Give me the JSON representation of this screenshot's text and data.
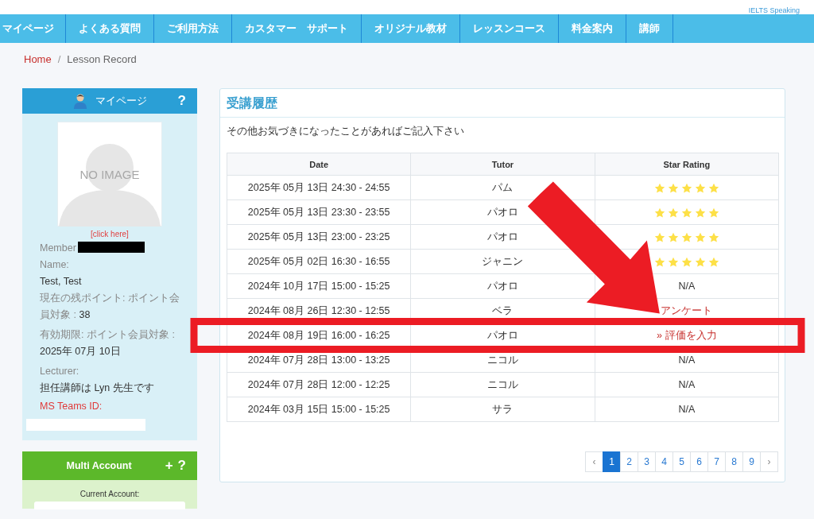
{
  "header_link": "IELTS Speaking",
  "nav": [
    {
      "label": "マイページ"
    },
    {
      "label": "よくある質問"
    },
    {
      "label": "ご利用方法"
    },
    {
      "label": "カスタマー　サポート"
    },
    {
      "label": "オリジナル教材"
    },
    {
      "label": "レッスンコース"
    },
    {
      "label": "料金案内"
    },
    {
      "label": "講師"
    }
  ],
  "breadcrumb": {
    "home": "Home",
    "separator": "/",
    "current": "Lesson Record"
  },
  "profile": {
    "title": "マイページ",
    "help": "?",
    "photo_text": "NO IMAGE",
    "photo_link": "[click here]",
    "member_label": "Member",
    "name_label": "Name:",
    "name": "Test, Test",
    "points_label": "現在の残ポイント: ポイント会員対象 :",
    "points": "38",
    "expiry_label": "有効期限: ポイント会員対象 :",
    "expiry": "2025年 07月 10日",
    "lecturer_label": "Lecturer:",
    "lecturer": "担任講師は Lyn 先生です",
    "teams_label": "MS Teams ID:"
  },
  "multi_account": {
    "title": "Multi Account",
    "add": "+",
    "help": "?",
    "current_label": "Current Account:"
  },
  "record": {
    "title": "受講履歴",
    "note": "その他お気づきになったことがあればご記入下さい",
    "columns": [
      "Date",
      "Tutor",
      "Star Rating"
    ],
    "rows": [
      {
        "date": "2025年 05月 13日 24:30 - 24:55",
        "tutor": "パム",
        "rating": {
          "kind": "stars",
          "stars": 5
        },
        "highlighted": false
      },
      {
        "date": "2025年 05月 13日 23:30 - 23:55",
        "tutor": "パオロ",
        "rating": {
          "kind": "stars",
          "stars": 5
        },
        "highlighted": false
      },
      {
        "date": "2025年 05月 13日 23:00 - 23:25",
        "tutor": "パオロ",
        "rating": {
          "kind": "stars",
          "stars": 5
        },
        "highlighted": false
      },
      {
        "date": "2025年 05月 02日 16:30 - 16:55",
        "tutor": "ジャニン",
        "rating": {
          "kind": "stars",
          "stars": 5
        },
        "highlighted": false
      },
      {
        "date": "2024年 10月 17日 15:00 - 15:25",
        "tutor": "パオロ",
        "rating": {
          "kind": "text",
          "text": "N/A"
        },
        "highlighted": false
      },
      {
        "date": "2024年 08月 26日 12:30 - 12:55",
        "tutor": "ベラ",
        "rating": {
          "kind": "link",
          "text": "アンケート"
        },
        "highlighted": false
      },
      {
        "date": "2024年 08月 19日 16:00 - 16:25",
        "tutor": "パオロ",
        "rating": {
          "kind": "link",
          "text": "» 評価を入力"
        },
        "highlighted": true
      },
      {
        "date": "2024年 07月 28日 13:00 - 13:25",
        "tutor": "ニコル",
        "rating": {
          "kind": "text",
          "text": "N/A"
        },
        "highlighted": false
      },
      {
        "date": "2024年 07月 28日 12:00 - 12:25",
        "tutor": "ニコル",
        "rating": {
          "kind": "text",
          "text": "N/A"
        },
        "highlighted": false
      },
      {
        "date": "2024年 03月 15日 15:00 - 15:25",
        "tutor": "サラ",
        "rating": {
          "kind": "text",
          "text": "N/A"
        },
        "highlighted": false
      }
    ],
    "pagination": [
      {
        "label": "‹",
        "selected": false
      },
      {
        "label": "1",
        "selected": true
      },
      {
        "label": "2",
        "selected": false
      },
      {
        "label": "3",
        "selected": false
      },
      {
        "label": "4",
        "selected": false
      },
      {
        "label": "5",
        "selected": false
      },
      {
        "label": "6",
        "selected": false
      },
      {
        "label": "7",
        "selected": false
      },
      {
        "label": "8",
        "selected": false
      },
      {
        "label": "9",
        "selected": false
      },
      {
        "label": "›",
        "selected": false
      }
    ]
  }
}
